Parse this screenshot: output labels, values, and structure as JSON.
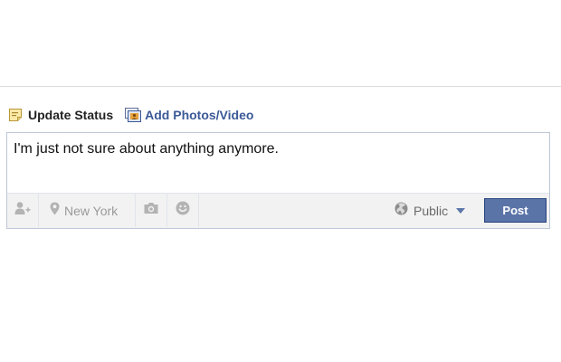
{
  "composer": {
    "tabs": {
      "update_status": "Update Status",
      "add_photos_video": "Add Photos/Video"
    },
    "status_text": "I'm just not sure about anything anymore.",
    "toolbar": {
      "tag_people_icon": "person-plus-icon",
      "location_icon": "map-pin-icon",
      "location_label": "New York",
      "photo_icon": "camera-icon",
      "feeling_icon": "smiley-icon"
    },
    "privacy": {
      "icon": "globe-icon",
      "label": "Public"
    },
    "post_label": "Post"
  },
  "colors": {
    "link_blue": "#3b5998",
    "post_button_bg": "#5b74a8",
    "composer_border": "#bdc7d8",
    "toolbar_bg": "#f2f2f2",
    "muted_text": "#9a9a9a"
  }
}
